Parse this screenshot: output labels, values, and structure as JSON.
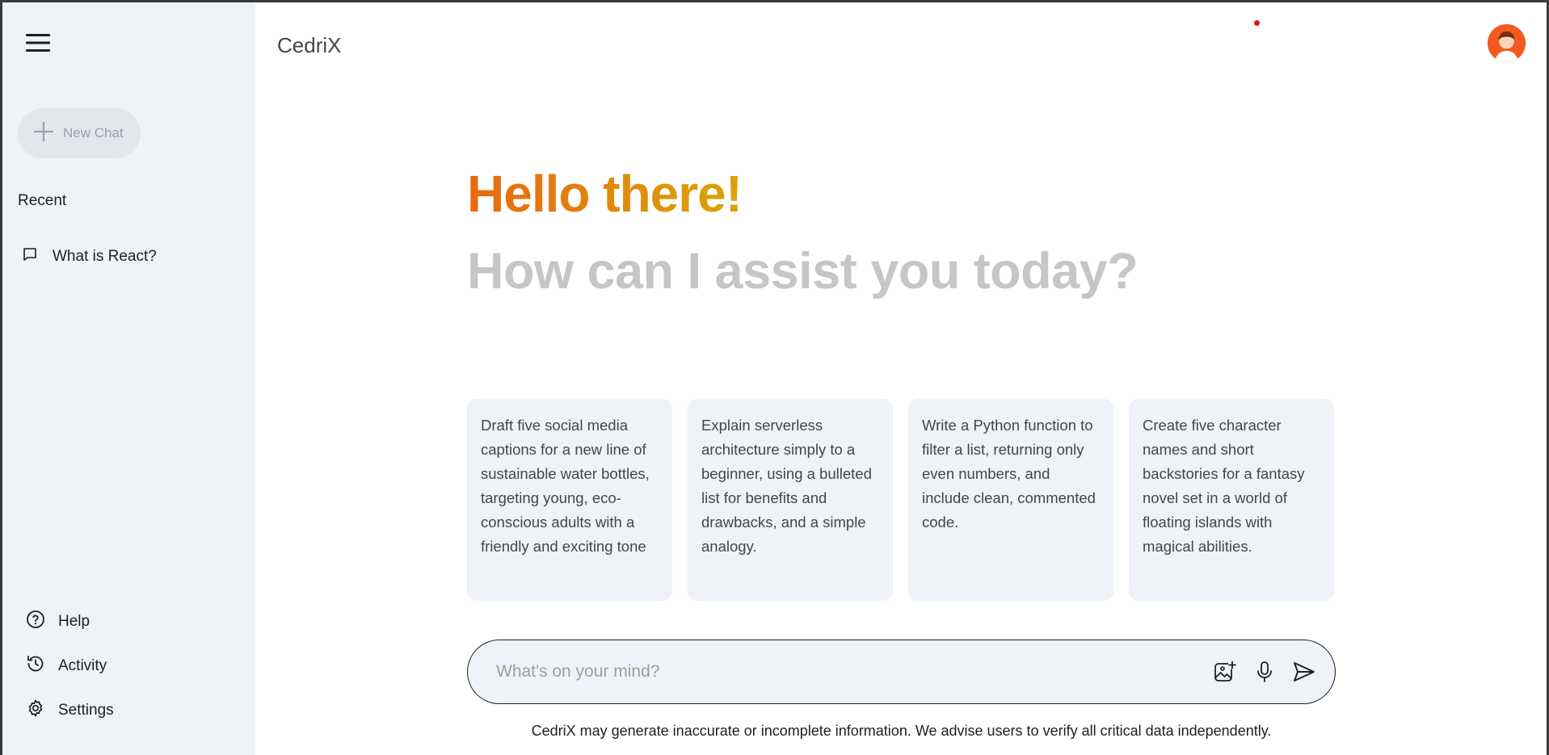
{
  "header": {
    "app_title": "CedriX"
  },
  "sidebar": {
    "new_chat_label": "New Chat",
    "recent_title": "Recent",
    "recent_items": [
      {
        "label": "What is React?"
      }
    ],
    "bottom_items": [
      {
        "label": "Help",
        "icon": "help-icon"
      },
      {
        "label": "Activity",
        "icon": "history-icon"
      },
      {
        "label": "Settings",
        "icon": "gear-icon"
      }
    ]
  },
  "main": {
    "greeting": "Hello there!",
    "subgreeting": "How can I assist you today?",
    "cards": [
      {
        "text": "Draft five social media captions for a new line of sustainable water bottles, targeting young, eco-conscious adults with a friendly and exciting tone"
      },
      {
        "text": "Explain serverless architecture simply to a beginner, using a bulleted list for benefits and drawbacks, and a simple analogy."
      },
      {
        "text": "Write a Python function to filter a list, returning only even numbers, and include clean, commented code."
      },
      {
        "text": "Create five character names and short backstories for a fantasy novel set in a world of floating islands with magical abilities."
      }
    ],
    "input": {
      "placeholder": "What's on your mind?",
      "value": ""
    },
    "disclaimer": "CedriX may generate inaccurate or incomplete information. We advise users to verify all critical data independently."
  },
  "colors": {
    "accent_gradient_start": "#e8690e",
    "accent_gradient_end": "#dba40c",
    "sidebar_bg": "#eff2f6",
    "avatar_bg": "#f25a22",
    "notification_dot": "#e0140f"
  }
}
